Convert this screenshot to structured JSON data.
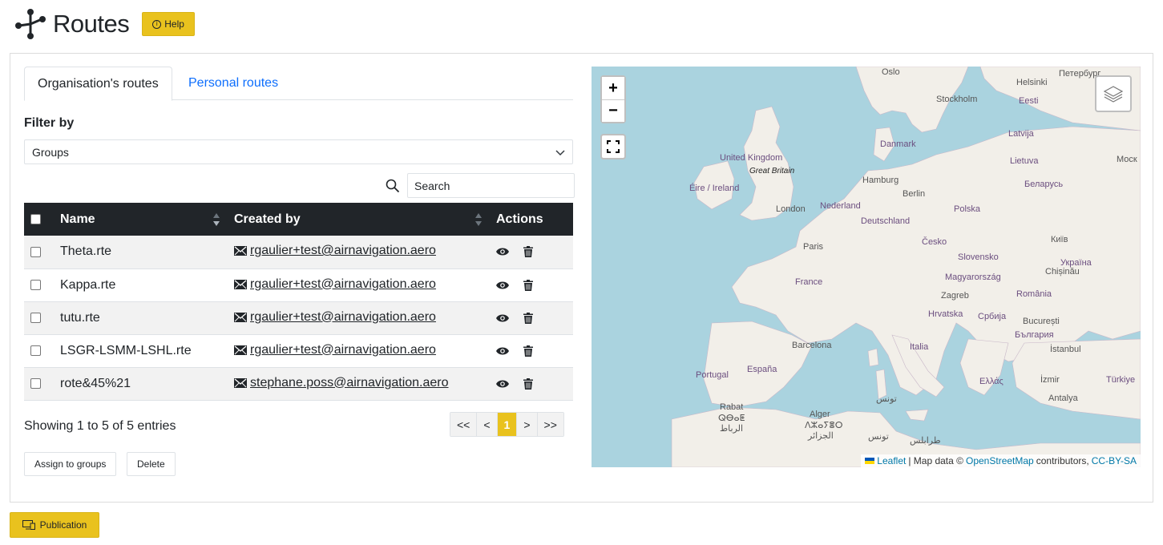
{
  "header": {
    "title": "Routes",
    "help_label": "Help"
  },
  "tabs": [
    {
      "label": "Organisation's routes",
      "active": true
    },
    {
      "label": "Personal routes",
      "active": false
    }
  ],
  "filter": {
    "label": "Filter by",
    "selected": "Groups"
  },
  "search": {
    "placeholder": "Search"
  },
  "table": {
    "columns": [
      "Name",
      "Created by",
      "Actions"
    ],
    "rows": [
      {
        "name": "Theta.rte",
        "created_by": " rgaulier+test@airnavigation.aero"
      },
      {
        "name": "Kappa.rte",
        "created_by": " rgaulier+test@airnavigation.aero"
      },
      {
        "name": "tutu.rte",
        "created_by": " rgaulier+test@airnavigation.aero"
      },
      {
        "name": "LSGR-LSMM-LSHL.rte",
        "created_by": " rgaulier+test@airnavigation.aero"
      },
      {
        "name": "rote&45%21",
        "created_by": " stephane.poss@airnavigation.aero"
      }
    ]
  },
  "footer": {
    "showing": "Showing 1 to 5 of 5 entries",
    "assign_label": "Assign to groups",
    "delete_label": "Delete"
  },
  "pagination": {
    "first": "<<",
    "prev": "<",
    "current": "1",
    "next": ">",
    "last": ">>"
  },
  "map": {
    "zoom_in": "+",
    "zoom_out": "−",
    "labels": {
      "oslo": "Oslo",
      "helsinki": "Helsinki",
      "peterburg": "Петербург",
      "stockholm": "Stockholm",
      "eesti": "Eesti",
      "latvija": "Latvija",
      "danmark": "Danmark",
      "uk": "United Kingdom",
      "great_britain": "Great Britain",
      "lietuva": "Lietuva",
      "moscow": "Моск",
      "eire": "Éire / Ireland",
      "hamburg": "Hamburg",
      "berlin": "Berlin",
      "belarus": "Беларусь",
      "london": "London",
      "nederland": "Nederland",
      "polska": "Polska",
      "deutschland": "Deutschland",
      "cesko": "Česko",
      "kyiv": "Київ",
      "paris": "Paris",
      "slovensko": "Slovensko",
      "ukraina": "Україна",
      "chisinau": "Chișinău",
      "france": "France",
      "magyarorszag": "Magyarország",
      "zagreb": "Zagreb",
      "romania": "România",
      "hrvatska": "Hrvatska",
      "srbija": "Србија",
      "bucuresti": "București",
      "barcelona": "Barcelona",
      "italia": "Italia",
      "bulgaria": "България",
      "istanbul": "İstanbul",
      "portugal": "Portugal",
      "espana": "España",
      "ellas": "Ελλάς",
      "izmir": "İzmir",
      "turkiye": "Türkiye",
      "tunis": "تونس",
      "antalya": "Antalya",
      "rabat": "Rabat",
      "rabat_tf": "ⵕⴱⴰⵟ",
      "rabat_ar": "الرباط",
      "alger": "Alger",
      "alger_tf": "ⴷⵣⴰⵢⴻⵔ",
      "alger_ar": "الجزائر",
      "tounes": "تونس",
      "tripoli": "طرابلس"
    },
    "attribution": {
      "leaflet": "Leaflet",
      "text1": "| Map data ©",
      "osm": "OpenStreetMap",
      "text2": "contributors,",
      "license": "CC-BY-SA"
    }
  },
  "publication_label": "Publication",
  "colors": {
    "accent": "#e9c21e",
    "table_header": "#212529",
    "link": "#0d6efd",
    "sea": "#aad3df",
    "land": "#f2efe9"
  }
}
